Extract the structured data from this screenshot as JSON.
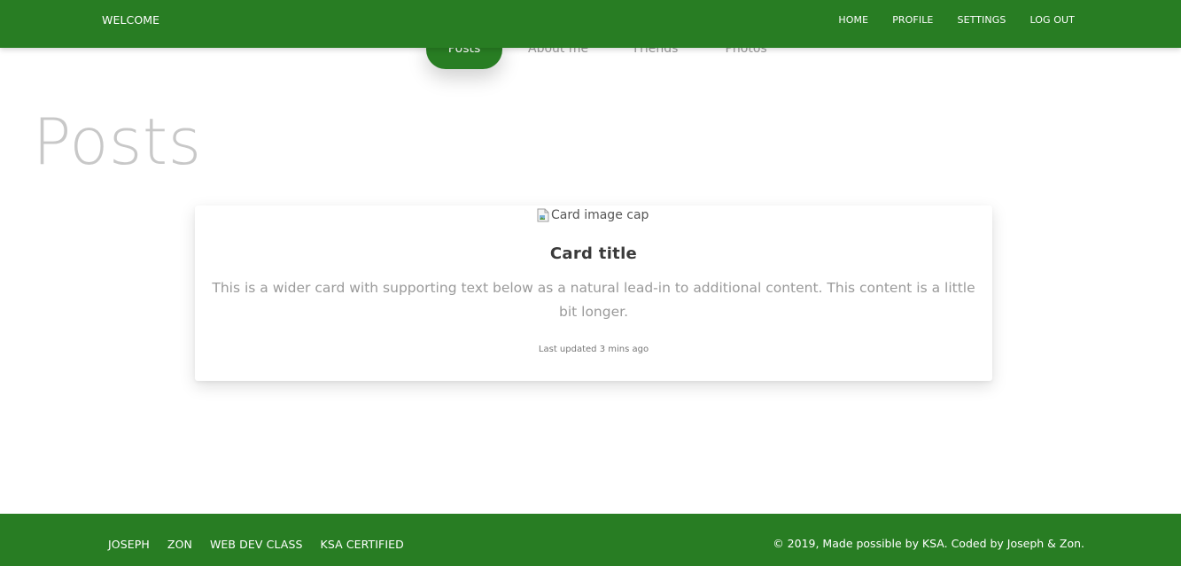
{
  "navbar": {
    "brand": "WELCOME",
    "links": [
      "HOME",
      "PROFILE",
      "SETTINGS",
      "LOG OUT"
    ],
    "background_color": "#287d23"
  },
  "tabs": {
    "items": [
      "Posts",
      "About me",
      "Friends",
      "Photos"
    ],
    "active": "Posts"
  },
  "page": {
    "heading": "Posts"
  },
  "card": {
    "image_alt": "Card image cap",
    "image_icon": "broken-image-icon",
    "title": "Card title",
    "text": "This is a wider card with supporting text below as a natural lead-in to additional content. This content is a little bit longer.",
    "updated": "Last updated 3 mins ago"
  },
  "footer": {
    "links": [
      "JOSEPH",
      "ZON",
      "WEB DEV CLASS",
      "KSA CERTIFIED"
    ],
    "copyright": "© 2019, Made possible by KSA. Coded by Joseph & Zon."
  }
}
